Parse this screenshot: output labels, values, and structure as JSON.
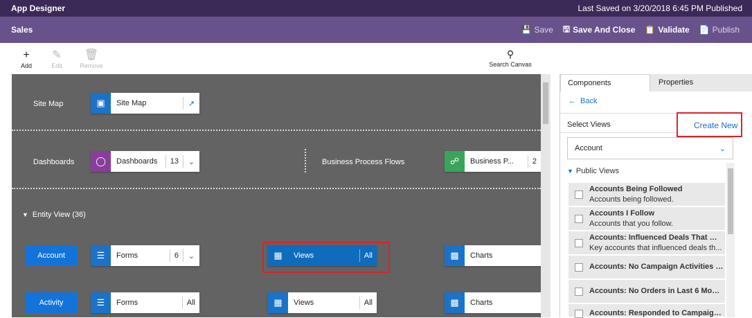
{
  "topbar": {
    "app_title": "App Designer",
    "last_saved": "Last Saved on 3/20/2018 6:45 PM Published"
  },
  "titlebar": {
    "title": "Sales",
    "save": "Save",
    "save_and_close": "Save And Close",
    "validate": "Validate",
    "publish": "Publish"
  },
  "toolbar": {
    "add": "Add",
    "edit": "Edit",
    "remove": "Remove",
    "search_canvas": "Search Canvas"
  },
  "canvas": {
    "site_map_label": "Site Map",
    "site_map_tile": "Site Map",
    "dashboards_label": "Dashboards",
    "dashboards_tile": "Dashboards",
    "dashboards_count": "13",
    "bpf_label": "Business Process Flows",
    "bpf_tile": "Business P...",
    "bpf_count": "2",
    "entity_view_header": "Entity View (36)",
    "entities": [
      {
        "name": "Account",
        "forms": "Forms",
        "forms_count": "6",
        "views": "Views",
        "views_count": "All",
        "charts": "Charts"
      },
      {
        "name": "Activity",
        "forms": "Forms",
        "forms_count": "All",
        "views": "Views",
        "views_count": "All",
        "charts": "Charts"
      }
    ]
  },
  "panel": {
    "tab_components": "Components",
    "tab_properties": "Properties",
    "back": "Back",
    "select_views": "Select Views",
    "create_new": "Create New",
    "entity_dropdown": "Account",
    "public_views_header": "Public Views",
    "views": [
      {
        "title": "Accounts Being Followed",
        "desc": "Accounts being followed."
      },
      {
        "title": "Accounts I Follow",
        "desc": "Accounts that you follow."
      },
      {
        "title": "Accounts: Influenced Deals That We ...",
        "desc": "Key accounts that influenced deals th..."
      },
      {
        "title": "Accounts: No Campaign Activities in...",
        "desc": ""
      },
      {
        "title": "Accounts: No Orders in Last 6 Months",
        "desc": ""
      },
      {
        "title": "Accounts: Responded to Campaigns ...",
        "desc": ""
      }
    ]
  },
  "colors": {
    "top_bar": "#3b2a57",
    "title_bar": "#68528b",
    "canvas": "#636363",
    "accent_blue": "#0f6cbd",
    "highlight_red": "#d6242c"
  }
}
